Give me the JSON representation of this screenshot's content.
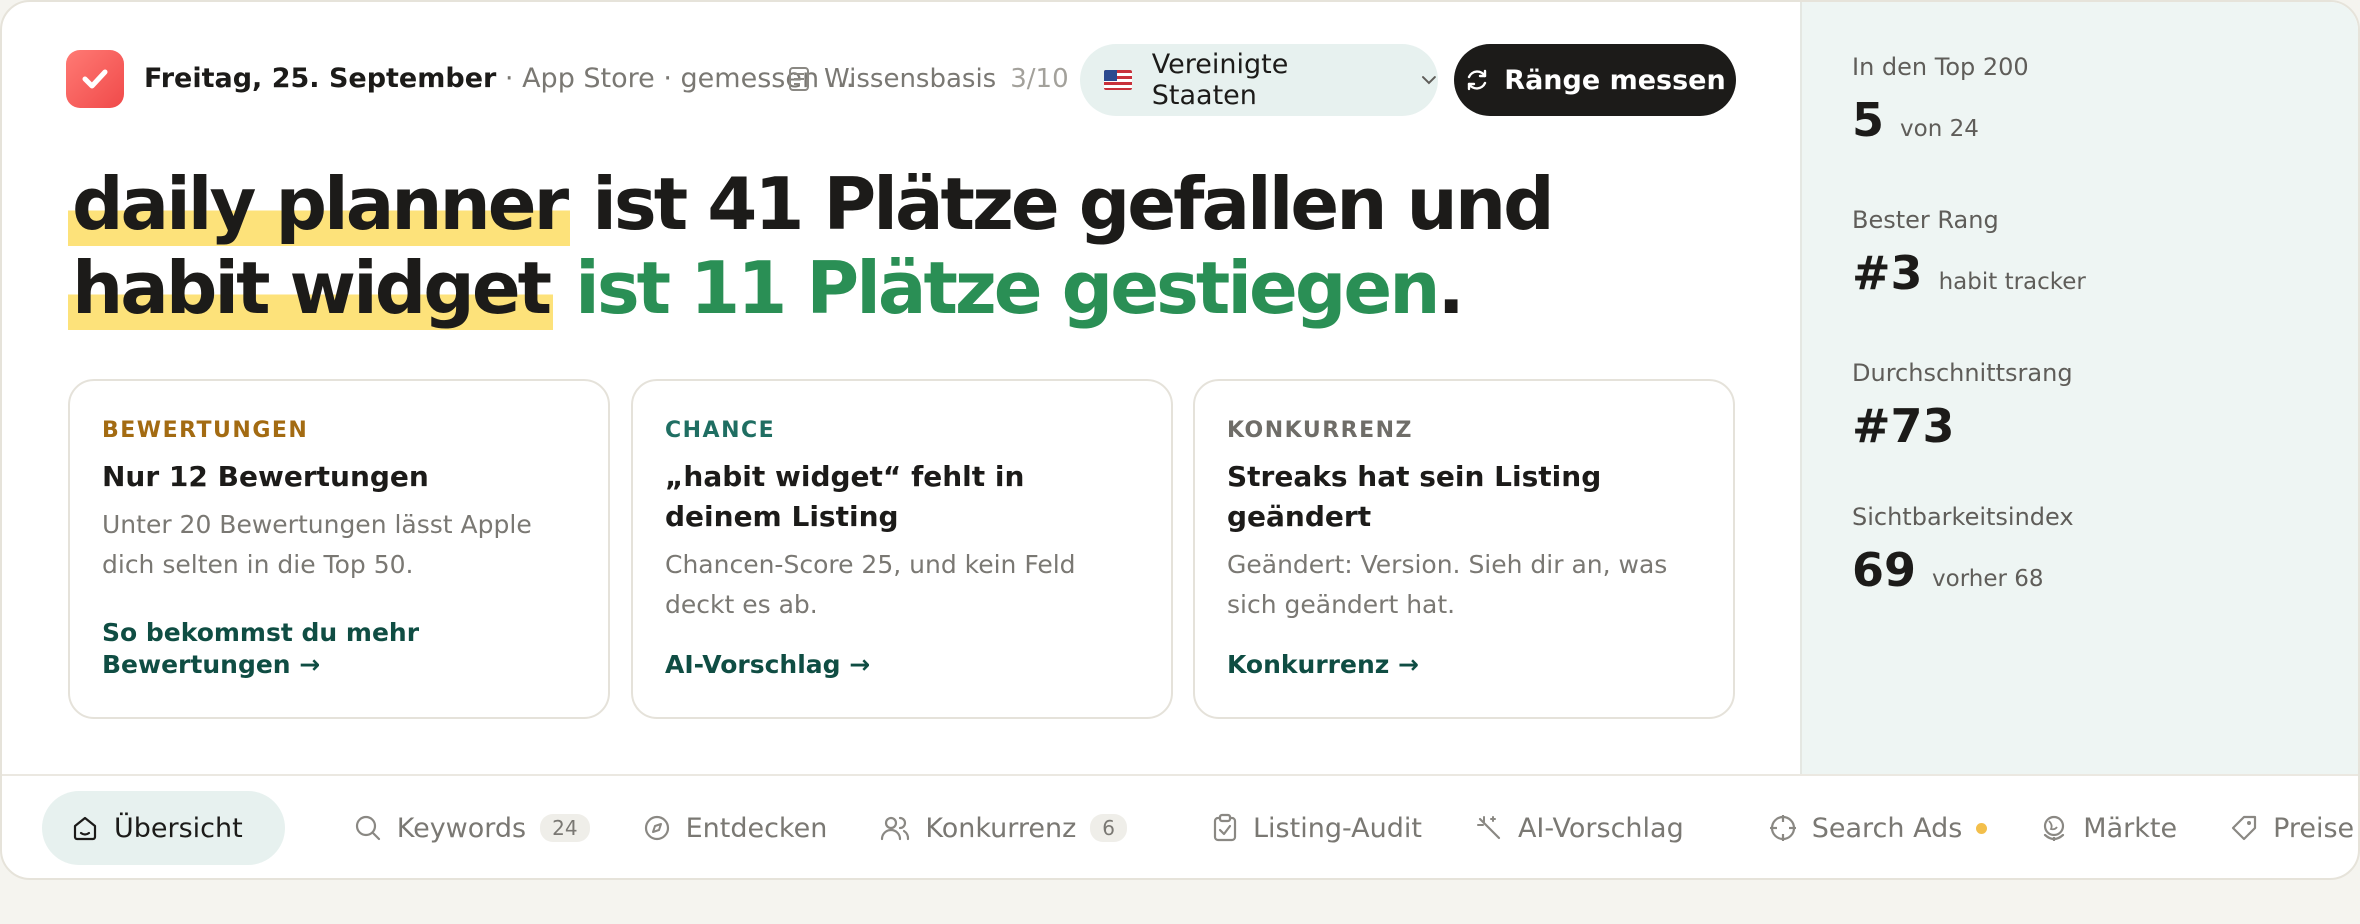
{
  "header": {
    "date": "Freitag, 25. September",
    "meta": " · App Store · gemessen …",
    "knowledge_base": "Wissensbasis",
    "knowledge_count": "3/10",
    "country": "Vereinigte Staaten",
    "measure_button": "Ränge messen"
  },
  "headline": {
    "kw1": "daily planner",
    "text1": " ist 41 Plätze gefallen und",
    "kw2": "habit widget",
    "text2": " ist 11 Plätze gestiegen",
    "end": "."
  },
  "cards": [
    {
      "kicker": "BEWERTUNGEN",
      "kicker_color": "#a36b12",
      "title": "Nur 12 Bewertungen",
      "desc": "Unter 20 Bewertungen lässt Apple dich selten in die Top 50.",
      "link": "So bekommst du mehr Bewertungen →"
    },
    {
      "kicker": "CHANCE",
      "kicker_color": "#1f6e62",
      "title": "„habit widget“ fehlt in deinem Listing",
      "desc": "Chancen-Score 25, und kein Feld deckt es ab.",
      "link": "AI-Vorschlag →"
    },
    {
      "kicker": "KONKURRENZ",
      "kicker_color": "#6f6d68",
      "title": "Streaks hat sein Listing geändert",
      "desc": "Geändert: Version. Sieh dir an, was sich geändert hat.",
      "link": "Konkurrenz →"
    }
  ],
  "stats": [
    {
      "label": "In den Top 200",
      "value": "5",
      "sub": "von 24"
    },
    {
      "label": "Bester Rang",
      "value": "#3",
      "sub": "habit tracker"
    },
    {
      "label": "Durchschnittsrang",
      "value": "#73",
      "sub": ""
    },
    {
      "label": "Sichtbarkeitsindex",
      "value": "69",
      "sub": "vorher 68"
    }
  ],
  "nav": {
    "overview": "Übersicht",
    "keywords": "Keywords",
    "keywords_count": "24",
    "discover": "Entdecken",
    "competition": "Konkurrenz",
    "competition_count": "6",
    "audit": "Listing-Audit",
    "ai": "AI-Vorschlag",
    "search_ads": "Search Ads",
    "markets": "Märkte",
    "prices": "Preise"
  }
}
